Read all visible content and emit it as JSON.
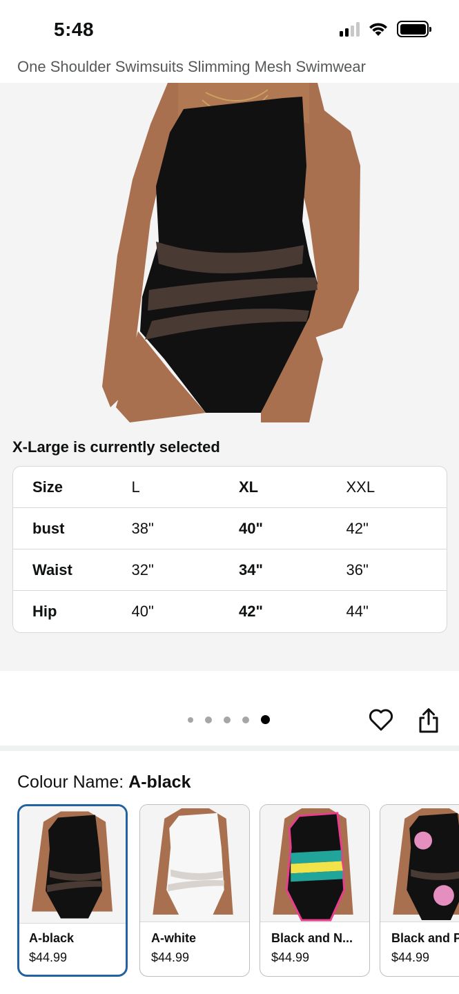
{
  "status_bar": {
    "time": "5:48",
    "signal_icon": "signal-icon",
    "wifi_icon": "wifi-icon",
    "battery_icon": "battery-icon"
  },
  "product": {
    "title": "One Shoulder Swimsuits Slimming Mesh Swimwear"
  },
  "size_chart": {
    "selected_note": "X-Large is currently selected",
    "rows": [
      {
        "label": "Size",
        "l": "L",
        "xl": "XL",
        "xxl": "XXL"
      },
      {
        "label": "bust",
        "l": "38\"",
        "xl": "40\"",
        "xxl": "42\""
      },
      {
        "label": "Waist",
        "l": "32\"",
        "xl": "34\"",
        "xxl": "36\""
      },
      {
        "label": "Hip",
        "l": "40\"",
        "xl": "42\"",
        "xxl": "44\""
      }
    ]
  },
  "carousel": {
    "total_images": 5,
    "active_image": 5
  },
  "actions": {
    "wishlist_icon": "heart-icon",
    "share_icon": "share-icon"
  },
  "colour": {
    "label": "Colour Name: ",
    "selected": "A-black",
    "options": [
      {
        "name": "A-black",
        "price": "$44.99",
        "selected": true
      },
      {
        "name": "A-white",
        "price": "$44.99",
        "selected": false
      },
      {
        "name": "Black and N...",
        "price": "$44.99",
        "selected": false
      },
      {
        "name": "Black and P",
        "price": "$44.99",
        "selected": false
      }
    ]
  },
  "colors": {
    "selected_border": "#2162a1",
    "text": "#0f1111",
    "muted": "#565959"
  }
}
